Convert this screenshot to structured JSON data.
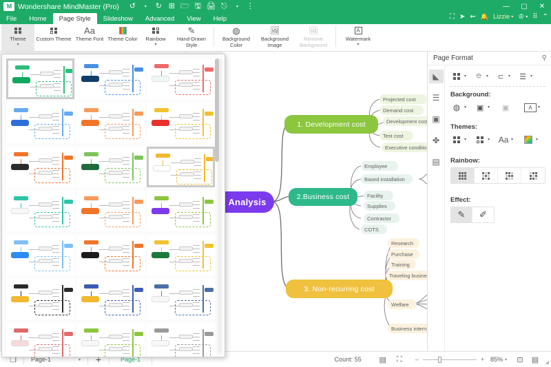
{
  "titlebar": {
    "app_title": "Wondershare MindMaster (Pro)",
    "logo_text": "M",
    "quick_access": [
      {
        "name": "undo-icon",
        "glyph": "↺"
      },
      {
        "name": "undo-dropdown-icon",
        "glyph": "▾"
      },
      {
        "name": "redo-icon",
        "glyph": "↻"
      },
      {
        "name": "new-icon",
        "glyph": "⊞"
      },
      {
        "name": "open-icon",
        "glyph": "🗁"
      },
      {
        "name": "save-icon",
        "glyph": "🖫"
      },
      {
        "name": "print-icon",
        "glyph": "🖨"
      },
      {
        "name": "export-icon",
        "glyph": "⎋"
      },
      {
        "name": "export-dropdown-icon",
        "glyph": "▾"
      },
      {
        "name": "more-qat-icon",
        "glyph": "⋮"
      }
    ],
    "window_buttons": [
      {
        "name": "minimize-button",
        "glyph": "—"
      },
      {
        "name": "maximize-button",
        "glyph": "▢"
      },
      {
        "name": "close-button",
        "glyph": "✕"
      }
    ],
    "account_bar": [
      {
        "name": "fullscreen-icon",
        "glyph": "⛶"
      },
      {
        "name": "send-icon",
        "glyph": "➤"
      },
      {
        "name": "share-icon",
        "glyph": "⇜"
      },
      {
        "name": "notification-icon",
        "glyph": "🔔"
      }
    ],
    "account_name": "Lizzie",
    "account_caret": "▾",
    "after_account": [
      {
        "name": "upgrade-crown-icon",
        "glyph": "♔"
      },
      {
        "name": "upgrade-dropdown-icon",
        "glyph": "▾"
      },
      {
        "name": "apps-grid-icon",
        "glyph": "⠿"
      },
      {
        "name": "collapse-ribbon-icon",
        "glyph": "⌃"
      }
    ]
  },
  "menu_tabs": [
    {
      "label": "File",
      "active": false
    },
    {
      "label": "Home",
      "active": false
    },
    {
      "label": "Page Style",
      "active": true
    },
    {
      "label": "Slideshow",
      "active": false
    },
    {
      "label": "Advanced",
      "active": false
    },
    {
      "label": "View",
      "active": false
    },
    {
      "label": "Help",
      "active": false
    }
  ],
  "ribbon": {
    "groups": [
      {
        "buttons": [
          {
            "label": "Theme",
            "icon": "theme-grid-icon",
            "caret": true,
            "selected": true,
            "disabled": false
          },
          {
            "label": "Custom Theme",
            "icon": "custom-theme-icon",
            "caret": true,
            "selected": false,
            "disabled": false
          },
          {
            "label": "Theme Font",
            "icon": "theme-font-icon",
            "glyph": "Aa",
            "caret": true,
            "selected": false,
            "disabled": false
          },
          {
            "label": "Theme Color",
            "icon": "theme-color-icon",
            "caret": true,
            "selected": false,
            "disabled": false
          },
          {
            "label": "Rainbow",
            "icon": "rainbow-icon",
            "caret": true,
            "selected": false,
            "disabled": false
          },
          {
            "label": "Hand-Drawn Style",
            "icon": "hand-drawn-icon",
            "glyph": "✎",
            "caret": true,
            "selected": false,
            "disabled": false
          }
        ]
      },
      {
        "buttons": [
          {
            "label": "Background Color",
            "icon": "background-color-icon",
            "glyph": "◍",
            "caret": true,
            "selected": false,
            "disabled": false
          },
          {
            "label": "Background Image",
            "icon": "background-image-icon",
            "glyph": "🖼",
            "caret": true,
            "selected": false,
            "disabled": false
          },
          {
            "label": "Remove Background",
            "icon": "remove-background-icon",
            "glyph": "🖼",
            "caret": false,
            "selected": false,
            "disabled": true
          }
        ]
      },
      {
        "buttons": [
          {
            "label": "Watermark",
            "icon": "watermark-icon",
            "glyph": "A",
            "caret": true,
            "selected": false,
            "disabled": false
          }
        ]
      }
    ]
  },
  "mindmap": {
    "root": {
      "label": "Analysis",
      "color": "#7c3aed"
    },
    "branches": [
      {
        "label": "1. Development cost",
        "color": "#8cc63f",
        "sub_color": "#edf5e1",
        "children": [
          "Projected cost",
          "Demand cost",
          "Development cost",
          "Test cost",
          "Executive condition"
        ]
      },
      {
        "label": "2.Business cost",
        "color": "#2eb98a",
        "sub_color": "#e8f3ee",
        "children": [
          "Employee",
          "Based installation",
          "Facility",
          "Supplies",
          "Contractor",
          "COTS"
        ]
      },
      {
        "label": "3. Non-recurring cost",
        "color": "#efc13f",
        "sub_color": "#fbf1de",
        "children": [
          "Research",
          "Purchase",
          "Training",
          "Traveling business",
          "Welfare",
          "Business interruption"
        ]
      }
    ]
  },
  "right_panel": {
    "title": "Page Format",
    "pin_icon": "pin-icon",
    "pin_glyph": "⚲",
    "strip": [
      {
        "name": "style-brush-icon",
        "glyph": "◣",
        "selected": true
      },
      {
        "name": "outline-list-icon",
        "glyph": "☰",
        "selected": false
      },
      {
        "name": "image-frame-icon",
        "glyph": "▣",
        "selected": false
      },
      {
        "name": "clover-icon",
        "glyph": "✤",
        "selected": false
      },
      {
        "name": "task-board-icon",
        "glyph": "▤",
        "selected": false
      }
    ],
    "layout_row": [
      {
        "name": "layout-theme-icon",
        "glyph": "▦",
        "caret": true
      },
      {
        "name": "layout-structure-icon",
        "glyph": "⯐",
        "caret": true
      },
      {
        "name": "layout-branch-icon",
        "glyph": "⊂",
        "caret": true
      },
      {
        "name": "layout-numbering-icon",
        "glyph": "☰",
        "caret": true
      }
    ],
    "background_label": "Background:",
    "background_row": [
      {
        "name": "background-fill-icon",
        "glyph": "◍",
        "caret": true
      },
      {
        "name": "background-image-icon",
        "glyph": "▣",
        "caret": true
      },
      {
        "name": "remove-background-image-icon",
        "glyph": "▣",
        "caret": false
      },
      {
        "name": "watermark-text-icon",
        "glyph": "A",
        "caret": true
      }
    ],
    "themes_label": "Themes:",
    "themes_row": [
      {
        "name": "theme-preset-icon",
        "glyph": "▦",
        "caret": true
      },
      {
        "name": "custom-theme-icon",
        "glyph": "▤",
        "caret": true
      },
      {
        "name": "theme-font-icon",
        "glyph": "Aa",
        "caret": true
      },
      {
        "name": "theme-color-icon",
        "glyph": "▦",
        "caret": true
      }
    ],
    "rainbow_label": "Rainbow:",
    "rainbow_options": [
      {
        "name": "rainbow-option-1",
        "selected": true
      },
      {
        "name": "rainbow-option-2",
        "selected": false
      },
      {
        "name": "rainbow-option-3",
        "selected": false
      },
      {
        "name": "rainbow-option-4",
        "selected": false
      }
    ],
    "effect_label": "Effect:",
    "effect_options": [
      {
        "name": "effect-normal",
        "glyph": "✎",
        "selected": true
      },
      {
        "name": "effect-hand-drawn",
        "glyph": "✐",
        "selected": false
      }
    ]
  },
  "theme_gallery": {
    "selected_index": 0,
    "second_selected_index": 8,
    "thumbnails": [
      {
        "root": "#0fa85f",
        "accent": "#2bbf7a",
        "name": "theme-green"
      },
      {
        "root": "#123d6b",
        "accent": "#4a90e2",
        "name": "theme-navy-blue"
      },
      {
        "root": "#f0f8f7",
        "accent": "#f06a6a",
        "name": "theme-light-coral"
      },
      {
        "root": "#2d6fd8",
        "accent": "#6aa9f0",
        "name": "theme-blue"
      },
      {
        "root": "#f0752a",
        "accent": "#f59b5e",
        "name": "theme-orange"
      },
      {
        "root": "#e8302e",
        "accent": "#f2c230",
        "name": "theme-red-yellow"
      },
      {
        "root": "#2b2b2b",
        "accent": "#f0752a",
        "name": "theme-dark-orange"
      },
      {
        "root": "#1e6b3c",
        "accent": "#7dc45a",
        "name": "theme-forest"
      },
      {
        "root": "#ffffff",
        "accent": "#f2b830",
        "name": "theme-white-amber"
      },
      {
        "root": "#f7f7f7",
        "accent": "#2ec4a6",
        "name": "theme-mint"
      },
      {
        "root": "#f0752a",
        "accent": "#f59b5e",
        "name": "theme-tangerine"
      },
      {
        "root": "#7c3aed",
        "accent": "#8cc63f",
        "name": "theme-purple-green"
      },
      {
        "root": "#2d8cf0",
        "accent": "#7fc0f5",
        "name": "theme-sky"
      },
      {
        "root": "#1c1c1c",
        "accent": "#f0752a",
        "name": "theme-black-orange"
      },
      {
        "root": "#1e7a3c",
        "accent": "#f2c230",
        "name": "theme-green-gold"
      },
      {
        "root": "#f2b830",
        "accent": "#2b2b2b",
        "name": "theme-gold-black"
      },
      {
        "root": "#f2b830",
        "accent": "#3b5bb5",
        "name": "theme-amber-indigo"
      },
      {
        "root": "#f7f7f7",
        "accent": "#4a6fa5",
        "name": "theme-steel"
      },
      {
        "root": "#f7d8d8",
        "accent": "#e06a6a",
        "name": "theme-blush"
      },
      {
        "root": "#f7f7f7",
        "accent": "#8cc63f",
        "name": "theme-pale-green"
      },
      {
        "root": "#f7f7f7",
        "accent": "#9a9a9a",
        "name": "theme-grey"
      }
    ]
  },
  "status_bar": {
    "page_icon": "page-icon",
    "page_icon_glyph": "❐",
    "page_select_value": "Page-1",
    "page_select_caret": "▾",
    "add_page_glyph": "+",
    "current_page_tab": "Page-1",
    "count_label": "Count: 55",
    "view_buttons": [
      {
        "name": "fit-page-icon",
        "glyph": "▤"
      },
      {
        "name": "fit-window-icon",
        "glyph": "⛶"
      }
    ],
    "zoom_out_glyph": "–",
    "zoom_in_glyph": "+",
    "zoom_level": "85%",
    "zoom_caret": "▾",
    "focus_icon_glyph": "⊡",
    "split_icon_glyph": "▤",
    "resize_grip_glyph": "◢"
  }
}
